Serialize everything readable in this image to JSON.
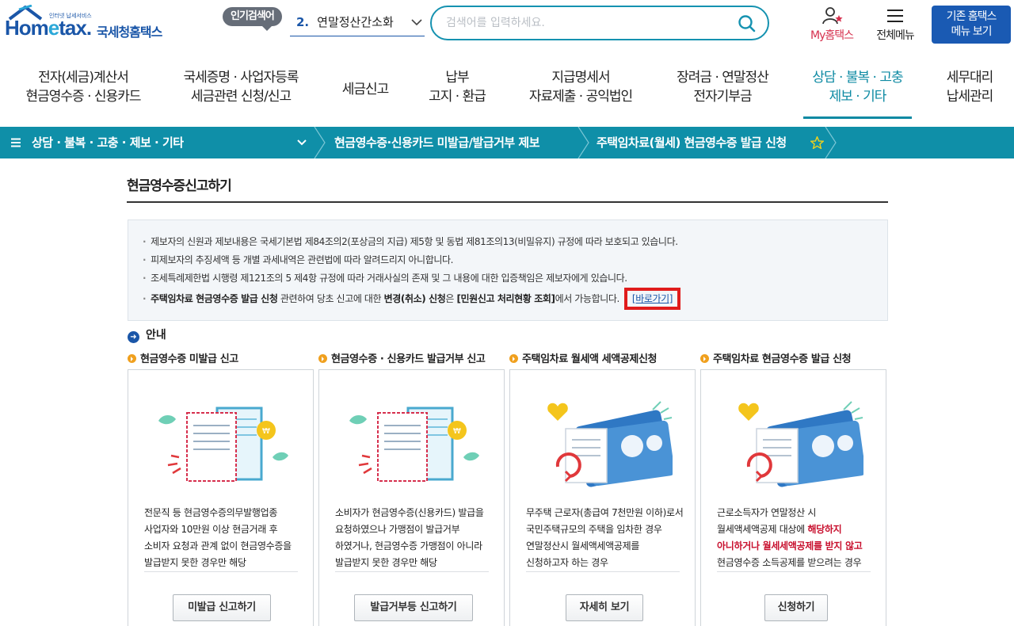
{
  "header": {
    "logo_text": "Hometax",
    "logo_tagline": "인터넷 납세서비스",
    "logo_brand": "국세청홈택스",
    "popular_badge": "인기검색어",
    "popular_rank": "2.",
    "popular_term": "연말정산간소화",
    "search_placeholder": "검색어를 입력하세요.",
    "my_hometax": "My홈택스",
    "all_menu": "전체메뉴",
    "legacy_line1": "기존 홈택스",
    "legacy_line2": "메뉴 보기"
  },
  "gnb": [
    {
      "l1": "전자(세금)계산서",
      "l2": "현금영수증 · 신용카드"
    },
    {
      "l1": "국세증명 · 사업자등록",
      "l2": "세금관련 신청/신고"
    },
    {
      "l1": "세금신고",
      "l2": ""
    },
    {
      "l1": "납부",
      "l2": "고지 · 환급"
    },
    {
      "l1": "지급명세서",
      "l2": "자료제출 · 공익법인"
    },
    {
      "l1": "장려금 · 연말정산",
      "l2": "전자기부금"
    },
    {
      "l1": "상담 · 불복 · 고충",
      "l2": "제보 · 기타"
    },
    {
      "l1": "세무대리",
      "l2": "납세관리"
    }
  ],
  "breadcrumb": {
    "menu": "상담 · 불복 · 고충 · 제보 · 기타",
    "level2": "현금영수증·신용카드 미발급/발급거부 제보",
    "level3": "주택임차료(월세) 현금영수증 발급 신청"
  },
  "page_title": "현금영수증신고하기",
  "notice": {
    "line1": "제보자의 신원과 제보내용은 국세기본법 제84조의2(포상금의 지급) 제5항 및 동법 제81조의13(비밀유지) 규정에 따라 보호되고 있습니다.",
    "line2": "피제보자의 추징세액 등 개별 과세내역은 관련법에 따라 알려드리지 아니합니다.",
    "line3": "조세특례제한법 시행령 제121조의 5 제4항 규정에 따라 거래사실의 존재 및 그 내용에 대한 입증책임은 제보자에게 있습니다.",
    "line4_b1": "주택임차료 현금영수증 발급 신청",
    "line4_t1": " 관련하여 당초 신고에 대한 ",
    "line4_b2": "변경(취소) 신청",
    "line4_t2": "은 ",
    "line4_b3": "[민원신고 처리현황 조회]",
    "line4_t3": "에서 가능합니다.",
    "shortcut": "[바로가기]"
  },
  "guide_title": "안내",
  "cards": [
    {
      "title": "현금영수증 미발급 신고",
      "desc": "전문직 등 현금영수증의무발행업종 사업자와 10만원 이상 현금거래 후 소비자 요청과 관계 없이 현금영수증을 발급받지 못한 경우만 해당",
      "button": "미발급 신고하기"
    },
    {
      "title": "현금영수증 · 신용카드 발급거부 신고",
      "desc": "소비자가 현금영수증(신용카드) 발급을 요청하였으나 가맹점이 발급거부 하였거나, 현금영수증 가맹점이 아니라 발급받지 못한 경우만 해당",
      "button": "발급거부등 신고하기"
    },
    {
      "title": "주택임차료 월세액 세액공제신청",
      "desc": "무주택 근로자(총급여 7천만원 이하)로서 국민주택규모의 주택을 임차한 경우 연말정산시 월세액세액공제를 신청하고자 하는 경우",
      "button": "자세히 보기"
    },
    {
      "title": "주택임차료 현금영수증 발급 신청",
      "desc_pre": "근로소득자가 연말정산 시 월세액세액공제 대상에 ",
      "desc_red": "해당하지 아니하거나 월세세액공제를 받지 않고",
      "desc_post": " 현금영수증 소득공제를 받으려는 경우",
      "button": "신청하기"
    }
  ],
  "colors": {
    "teal": "#0f8fa8",
    "brand_blue": "#1a5ab3",
    "highlight_red": "#e01c1c",
    "bullet_orange": "#f0a01e"
  }
}
